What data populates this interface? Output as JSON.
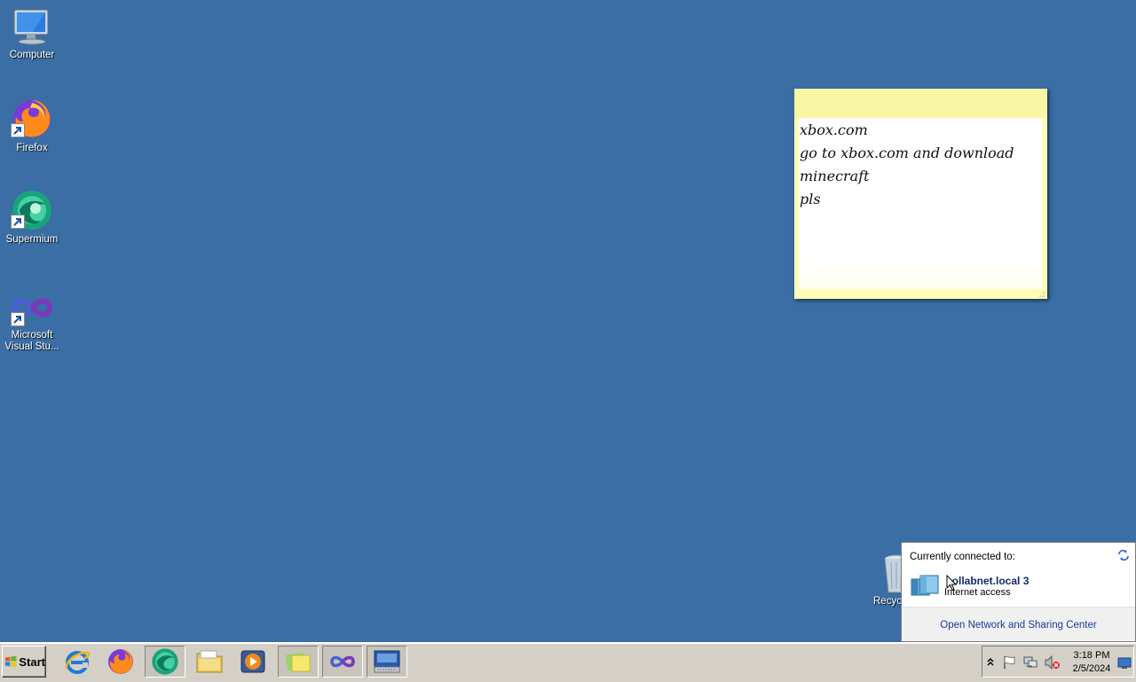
{
  "desktop": {
    "icons": [
      {
        "label": "Computer",
        "icon": "computer-icon"
      },
      {
        "label": "Firefox",
        "icon": "firefox-icon"
      },
      {
        "label": "Supermium",
        "icon": "supermium-icon"
      },
      {
        "label_line1": "Microsoft",
        "label_line2": "Visual Stu...",
        "icon": "visual-studio-icon"
      }
    ],
    "recycle_bin_label": "Recyc"
  },
  "sticky_note": {
    "lines": [
      "xbox.com",
      "go to xbox.com and download",
      "minecraft",
      "pls"
    ]
  },
  "network_popup": {
    "header": "Currently connected to:",
    "network_name": "collabnet.local  3",
    "network_status": "Internet access",
    "footer_link": "Open Network and Sharing Center"
  },
  "taskbar": {
    "start_label": "Start",
    "pinned": [
      "internet-explorer-icon",
      "firefox-icon",
      "supermium-icon",
      "file-explorer-icon",
      "media-player-icon",
      "sticky-notes-icon",
      "visual-studio-icon",
      "on-screen-keyboard-icon"
    ],
    "tray": {
      "time": "3:18 PM",
      "date": "2/5/2024"
    }
  },
  "colors": {
    "desktop_bg": "#3a6ea5",
    "sticky_yellow": "#fdfdb6",
    "link_blue": "#1c3a94"
  }
}
